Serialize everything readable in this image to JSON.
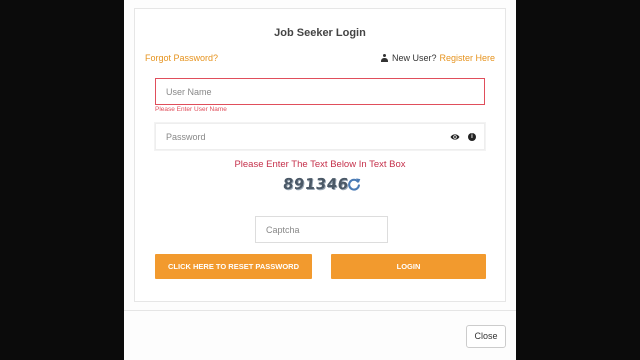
{
  "modal": {
    "title": "Job Seeker Login",
    "forgot_password": "Forgot Password?",
    "new_user_text": "New User?",
    "register_link": "Register Here",
    "username": {
      "placeholder": "User Name",
      "error": "Please Enter User Name"
    },
    "password": {
      "placeholder": "Password"
    },
    "captcha": {
      "message": "Please Enter The Text Below In Text Box",
      "code": "891346",
      "placeholder": "Captcha"
    },
    "buttons": {
      "reset": "CLICK HERE TO RESET PASSWORD",
      "login": "LOGIN",
      "close": "Close"
    }
  },
  "colors": {
    "accent": "#f29a2e",
    "link": "#e6931e",
    "error": "#e04e5b"
  },
  "icons": [
    "user-icon",
    "eye-icon",
    "info-icon",
    "refresh-icon"
  ]
}
